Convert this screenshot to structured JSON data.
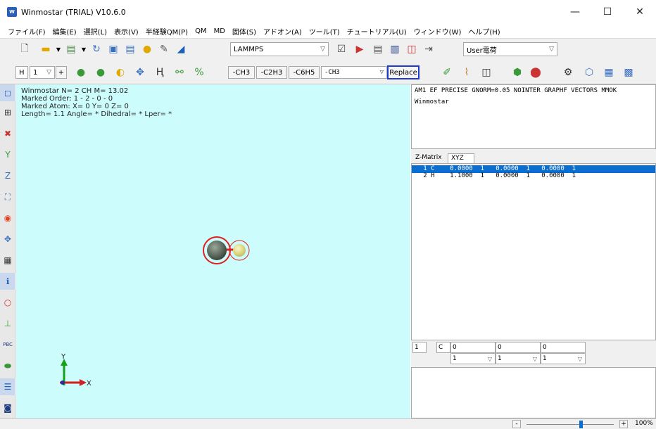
{
  "window": {
    "title": "Winmostar (TRIAL) V10.6.0",
    "icon_label": "W",
    "minimize": "—",
    "maximize": "☐",
    "close": "✕"
  },
  "menu": [
    "ファイル(F)",
    "編集(E)",
    "選択(L)",
    "表示(V)",
    "半経験QM(P)",
    "QM",
    "MD",
    "固体(S)",
    "アドオン(A)",
    "ツール(T)",
    "チュートリアル(U)",
    "ウィンドウ(W)",
    "ヘルプ(H)"
  ],
  "toolbar1": {
    "engine_select": "LAMMPS",
    "job_select": "User電荷"
  },
  "toolbar2": {
    "element_value": "H",
    "bond_value": "1",
    "plus_label": "+",
    "frag_ch3": "-CH3",
    "frag_c2h3": "-C2H3",
    "frag_c6h5": "-C6H5",
    "frag_select": "-CH3",
    "replace_label": "Replace"
  },
  "viewport": {
    "line1": "Winmostar  N= 2  CH  M= 13.02",
    "line2": "Marked Order: 1 - 2 - 0 - 0",
    "line3": "Marked Atom: X= 0 Y= 0 Z= 0",
    "line4": "Length= 1.1 Angle= * Dihedral= * Lper= *",
    "axis_x": "X",
    "axis_y": "Y",
    "colors": {
      "background": "#ccfcfc",
      "carbon": "#4d5a4d",
      "hydrogen": "#e6e27a",
      "marker": "#e02020"
    }
  },
  "keywords": {
    "line1": "AM1 EF PRECISE GNORM=0.05 NOINTER GRAPHF VECTORS MMOK",
    "line2": "Winmostar"
  },
  "tabs": {
    "zmatrix": "Z-Matrix",
    "xyz": "XYZ"
  },
  "atoms": [
    {
      "row": "   1 C    0.0000  1   0.0000  1   0.0000  1"
    },
    {
      "row": "   2 H    1.1000  1   0.0000  1   0.0000  1"
    }
  ],
  "editor": {
    "index": "1",
    "element": "C",
    "x": "0",
    "y": "0",
    "z": "0",
    "flag_x": "1",
    "flag_y": "1",
    "flag_z": "1"
  },
  "statusbar": {
    "zoom_minus": "-",
    "zoom_plus": "+",
    "zoom_value": "100%",
    "zoom_level": 0.62
  }
}
